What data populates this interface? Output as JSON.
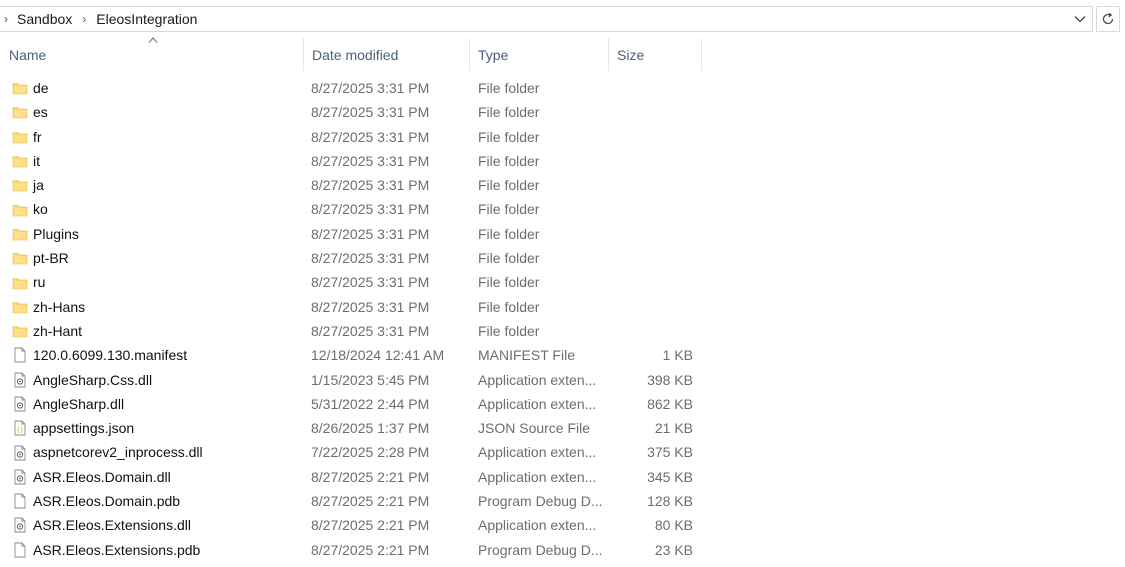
{
  "address": {
    "crumbs": [
      "Sandbox",
      "EleosIntegration"
    ]
  },
  "columns": {
    "name": "Name",
    "date": "Date modified",
    "type": "Type",
    "size": "Size"
  },
  "files": [
    {
      "icon": "folder-icon",
      "name": "de",
      "date": "8/27/2025 3:31 PM",
      "type": "File folder",
      "size": ""
    },
    {
      "icon": "folder-icon",
      "name": "es",
      "date": "8/27/2025 3:31 PM",
      "type": "File folder",
      "size": ""
    },
    {
      "icon": "folder-icon",
      "name": "fr",
      "date": "8/27/2025 3:31 PM",
      "type": "File folder",
      "size": ""
    },
    {
      "icon": "folder-icon",
      "name": "it",
      "date": "8/27/2025 3:31 PM",
      "type": "File folder",
      "size": ""
    },
    {
      "icon": "folder-icon",
      "name": "ja",
      "date": "8/27/2025 3:31 PM",
      "type": "File folder",
      "size": ""
    },
    {
      "icon": "folder-icon",
      "name": "ko",
      "date": "8/27/2025 3:31 PM",
      "type": "File folder",
      "size": ""
    },
    {
      "icon": "folder-icon",
      "name": "Plugins",
      "date": "8/27/2025 3:31 PM",
      "type": "File folder",
      "size": ""
    },
    {
      "icon": "folder-icon",
      "name": "pt-BR",
      "date": "8/27/2025 3:31 PM",
      "type": "File folder",
      "size": ""
    },
    {
      "icon": "folder-icon",
      "name": "ru",
      "date": "8/27/2025 3:31 PM",
      "type": "File folder",
      "size": ""
    },
    {
      "icon": "folder-icon",
      "name": "zh-Hans",
      "date": "8/27/2025 3:31 PM",
      "type": "File folder",
      "size": ""
    },
    {
      "icon": "folder-icon",
      "name": "zh-Hant",
      "date": "8/27/2025 3:31 PM",
      "type": "File folder",
      "size": ""
    },
    {
      "icon": "file-icon",
      "name": "120.0.6099.130.manifest",
      "date": "12/18/2024 12:41 AM",
      "type": "MANIFEST File",
      "size": "1 KB"
    },
    {
      "icon": "dll-icon",
      "name": "AngleSharp.Css.dll",
      "date": "1/15/2023 5:45 PM",
      "type": "Application exten...",
      "size": "398 KB"
    },
    {
      "icon": "dll-icon",
      "name": "AngleSharp.dll",
      "date": "5/31/2022 2:44 PM",
      "type": "Application exten...",
      "size": "862 KB"
    },
    {
      "icon": "json-icon",
      "name": "appsettings.json",
      "date": "8/26/2025 1:37 PM",
      "type": "JSON Source File",
      "size": "21 KB"
    },
    {
      "icon": "dll-icon",
      "name": "aspnetcorev2_inprocess.dll",
      "date": "7/22/2025 2:28 PM",
      "type": "Application exten...",
      "size": "375 KB"
    },
    {
      "icon": "dll-icon",
      "name": "ASR.Eleos.Domain.dll",
      "date": "8/27/2025 2:21 PM",
      "type": "Application exten...",
      "size": "345 KB"
    },
    {
      "icon": "file-icon",
      "name": "ASR.Eleos.Domain.pdb",
      "date": "8/27/2025 2:21 PM",
      "type": "Program Debug D...",
      "size": "128 KB"
    },
    {
      "icon": "dll-icon",
      "name": "ASR.Eleos.Extensions.dll",
      "date": "8/27/2025 2:21 PM",
      "type": "Application exten...",
      "size": "80 KB"
    },
    {
      "icon": "file-icon",
      "name": "ASR.Eleos.Extensions.pdb",
      "date": "8/27/2025 2:21 PM",
      "type": "Program Debug D...",
      "size": "23 KB"
    }
  ]
}
